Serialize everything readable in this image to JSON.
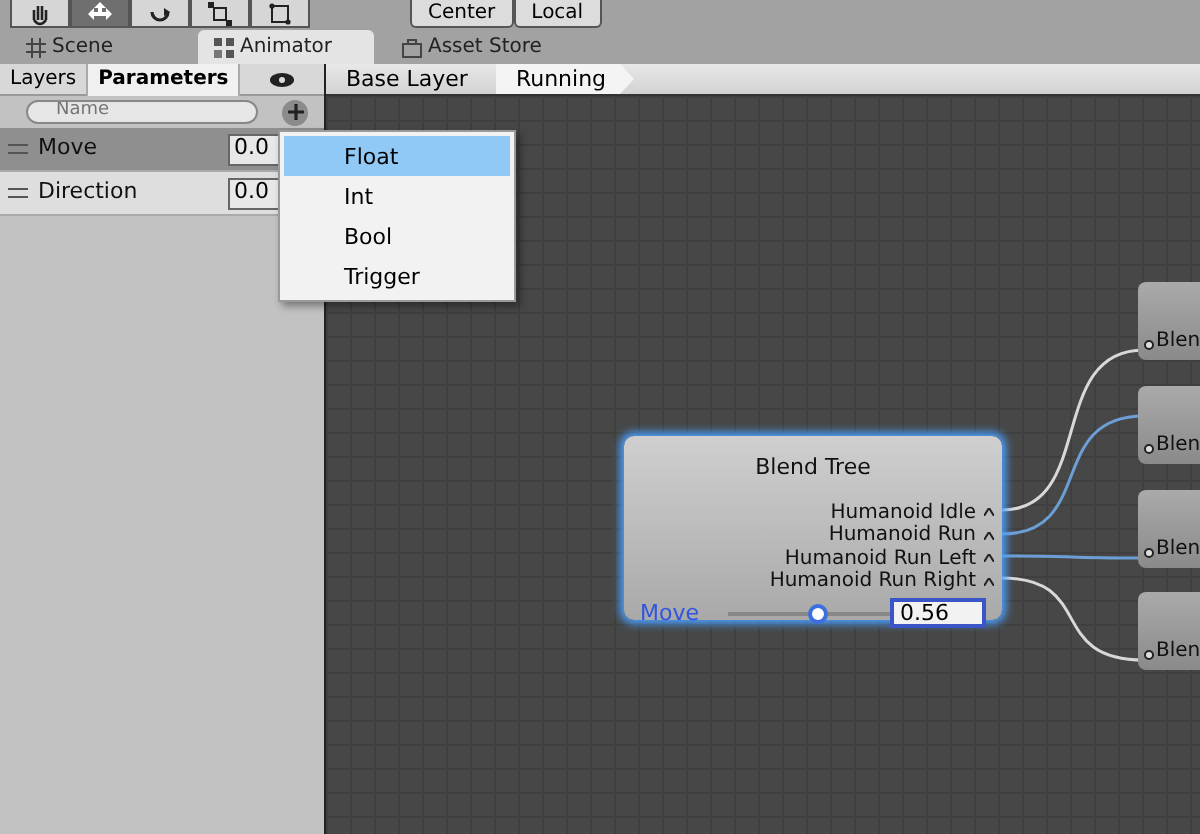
{
  "toolbar": {
    "tools": [
      {
        "kind": "hand",
        "selected": false
      },
      {
        "kind": "move",
        "selected": true
      },
      {
        "kind": "rotate",
        "selected": false
      },
      {
        "kind": "scale",
        "selected": false
      },
      {
        "kind": "rect",
        "selected": false
      }
    ],
    "pivot_buttons": [
      "Center",
      "Local"
    ]
  },
  "tabs": [
    {
      "label": "Scene",
      "kind": "scene",
      "selected": false
    },
    {
      "label": "Animator",
      "kind": "animator",
      "selected": true
    },
    {
      "label": "Asset Store",
      "kind": "store",
      "selected": false
    }
  ],
  "panel_tabs": [
    {
      "label": "Layers",
      "selected": false
    },
    {
      "label": "Parameters",
      "selected": true
    }
  ],
  "breadcrumb": [
    "Base Layer",
    "Running"
  ],
  "search": {
    "placeholder": "Name"
  },
  "parameters": [
    {
      "name": "Move",
      "value": "0.0",
      "selected": true
    },
    {
      "name": "Direction",
      "value": "0.0",
      "selected": false
    }
  ],
  "add_menu": [
    {
      "label": "Float",
      "selected": true
    },
    {
      "label": "Int",
      "selected": false
    },
    {
      "label": "Bool",
      "selected": false
    },
    {
      "label": "Trigger",
      "selected": false
    }
  ],
  "blend_tree": {
    "title": "Blend Tree",
    "motions": [
      {
        "label": "Humanoid Idle",
        "highlighted": false
      },
      {
        "label": "Humanoid Run",
        "highlighted": true
      },
      {
        "label": "Humanoid Run Left",
        "highlighted": true
      },
      {
        "label": "Humanoid Run Right",
        "highlighted": false
      }
    ],
    "parameter": "Move",
    "level": 0.56,
    "value": "0.56"
  },
  "child_nodes": [
    {
      "label": "Blen"
    },
    {
      "label": "Blen"
    },
    {
      "label": "Blen"
    },
    {
      "label": "Blen"
    }
  ]
}
